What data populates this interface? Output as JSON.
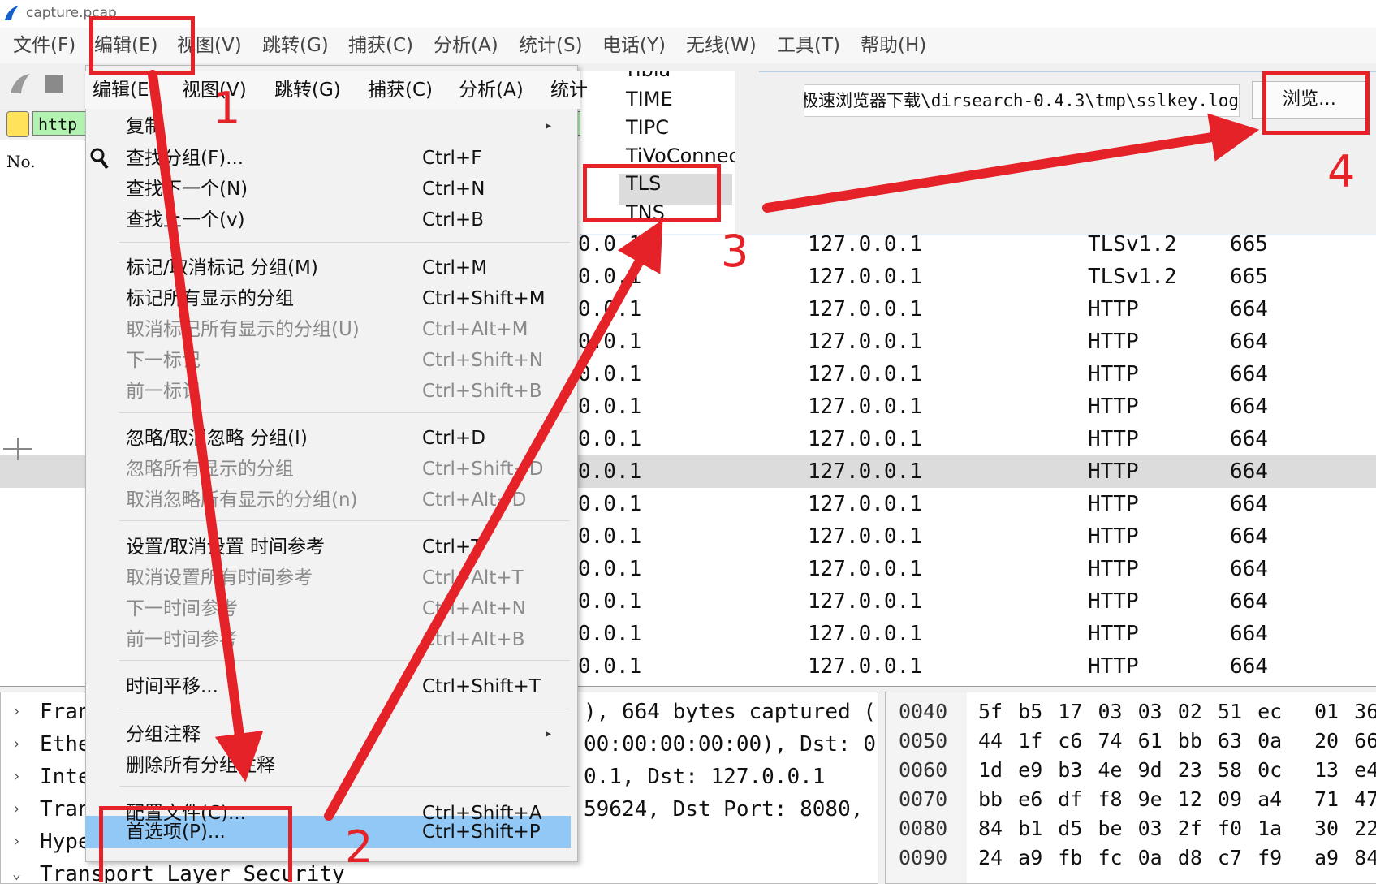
{
  "window": {
    "title": "capture.pcap"
  },
  "menubar": {
    "items": [
      "文件(F)",
      "编辑(E)",
      "视图(V)",
      "跳转(G)",
      "捕获(C)",
      "分析(A)",
      "统计(S)",
      "电话(Y)",
      "无线(W)",
      "工具(T)",
      "帮助(H)"
    ]
  },
  "filter": {
    "value": "http"
  },
  "packet_list": {
    "col_no": "No.",
    "rows": [
      {
        "src": "0.0.1",
        "dst": "127.0.0.1",
        "proto": "TLSv1.2",
        "len": "665"
      },
      {
        "src": "0.0.1",
        "dst": "127.0.0.1",
        "proto": "TLSv1.2",
        "len": "665"
      },
      {
        "src": "0.0.1",
        "dst": "127.0.0.1",
        "proto": "HTTP",
        "len": "664"
      },
      {
        "src": "0.0.1",
        "dst": "127.0.0.1",
        "proto": "HTTP",
        "len": "664"
      },
      {
        "src": "0.0.1",
        "dst": "127.0.0.1",
        "proto": "HTTP",
        "len": "664"
      },
      {
        "src": "0.0.1",
        "dst": "127.0.0.1",
        "proto": "HTTP",
        "len": "664"
      },
      {
        "src": "0.0.1",
        "dst": "127.0.0.1",
        "proto": "HTTP",
        "len": "664"
      },
      {
        "src": "0.0.1",
        "dst": "127.0.0.1",
        "proto": "HTTP",
        "len": "664"
      },
      {
        "src": "0.0.1",
        "dst": "127.0.0.1",
        "proto": "HTTP",
        "len": "664"
      },
      {
        "src": "0.0.1",
        "dst": "127.0.0.1",
        "proto": "HTTP",
        "len": "664"
      },
      {
        "src": "0.0.1",
        "dst": "127.0.0.1",
        "proto": "HTTP",
        "len": "664"
      },
      {
        "src": "0.0.1",
        "dst": "127.0.0.1",
        "proto": "HTTP",
        "len": "664"
      },
      {
        "src": "0.0.1",
        "dst": "127.0.0.1",
        "proto": "HTTP",
        "len": "664"
      },
      {
        "src": "0.0.1",
        "dst": "127.0.0.1",
        "proto": "HTTP",
        "len": "664"
      }
    ]
  },
  "details": {
    "rows": [
      {
        "label": "Fran",
        "tail": "), 664 bytes captured ("
      },
      {
        "label": "Ethe",
        "tail": "00:00:00:00:00), Dst: 0"
      },
      {
        "label": "Inte",
        "tail": "0.1, Dst: 127.0.0.1"
      },
      {
        "label": "Tran",
        "tail": "59624, Dst Port: 8080,"
      },
      {
        "label": "Hype",
        "tail": ""
      },
      {
        "label": "Transport Layer Security",
        "tail": ""
      }
    ]
  },
  "bytes": {
    "rows": [
      {
        "offset": "0040",
        "hex1": "5f b5 17 03 03 02 51 ec",
        "hex2": "01 36"
      },
      {
        "offset": "0050",
        "hex1": "44 1f c6 74 61 bb 63 0a",
        "hex2": "20 66"
      },
      {
        "offset": "0060",
        "hex1": "1d e9 b3 4e 9d 23 58 0c",
        "hex2": "13 e4"
      },
      {
        "offset": "0070",
        "hex1": "bb e6 df f8 9e 12 09 a4",
        "hex2": "71 47"
      },
      {
        "offset": "0080",
        "hex1": "84 b1 d5 be 03 2f f0 1a",
        "hex2": "30 22"
      },
      {
        "offset": "0090",
        "hex1": "24 a9 fb fc 0a d8 c7 f9",
        "hex2": "a9 84"
      }
    ]
  },
  "preferences": {
    "protocols": [
      "TIME",
      "TIPC",
      "TiVoConnec",
      "TLS",
      "TNS"
    ],
    "protocol_partial_top": "Tibia",
    "selected_protocol": "TLS",
    "keylog_path": "极速浏览器下载\\dirsearch-0.4.3\\tmp\\sslkey.log",
    "browse_label": "浏览…"
  },
  "edit_menu": {
    "bar": [
      "编辑(E)",
      "视图(V)",
      "跳转(G)",
      "捕获(C)",
      "分析(A)",
      "统计"
    ],
    "items": [
      {
        "label": "复制",
        "shortcut": "",
        "disabled": false,
        "submenu": true
      },
      {
        "label": "查找分组(F)...",
        "shortcut": "Ctrl+F",
        "disabled": false
      },
      {
        "label": "查找下一个(N)",
        "shortcut": "Ctrl+N",
        "disabled": false
      },
      {
        "label": "查找上一个(v)",
        "shortcut": "Ctrl+B",
        "disabled": false
      },
      {
        "label": "标记/取消标记 分组(M)",
        "shortcut": "Ctrl+M",
        "disabled": false
      },
      {
        "label": "标记所有显示的分组",
        "shortcut": "Ctrl+Shift+M",
        "disabled": false
      },
      {
        "label": "取消标记所有显示的分组(U)",
        "shortcut": "Ctrl+Alt+M",
        "disabled": true
      },
      {
        "label": "下一标记",
        "shortcut": "Ctrl+Shift+N",
        "disabled": true
      },
      {
        "label": "前一标记",
        "shortcut": "Ctrl+Shift+B",
        "disabled": true
      },
      {
        "label": "忽略/取消忽略 分组(I)",
        "shortcut": "Ctrl+D",
        "disabled": false
      },
      {
        "label": "忽略所有显示的分组",
        "shortcut": "Ctrl+Shift+D",
        "disabled": true
      },
      {
        "label": "取消忽略所有显示的分组(n)",
        "shortcut": "Ctrl+Alt+D",
        "disabled": true
      },
      {
        "label": "设置/取消设置 时间参考",
        "shortcut": "Ctrl+T",
        "disabled": false
      },
      {
        "label": "取消设置所有时间参考",
        "shortcut": "Ctrl+Alt+T",
        "disabled": true
      },
      {
        "label": "下一时间参考",
        "shortcut": "Ctrl+Alt+N",
        "disabled": true
      },
      {
        "label": "前一时间参考",
        "shortcut": "Ctrl+Alt+B",
        "disabled": true
      },
      {
        "label": "时间平移...",
        "shortcut": "Ctrl+Shift+T",
        "disabled": false
      },
      {
        "label": "分组注释",
        "shortcut": "",
        "disabled": false,
        "submenu": true
      },
      {
        "label": "删除所有分组注释",
        "shortcut": "",
        "disabled": false
      },
      {
        "label": "配置文件(C)...",
        "shortcut": "Ctrl+Shift+A",
        "disabled": false
      },
      {
        "label": "首选项(P)...",
        "shortcut": "Ctrl+Shift+P",
        "disabled": false,
        "highlighted": true
      }
    ]
  },
  "annotations": {
    "steps": [
      "1",
      "2",
      "3",
      "4"
    ],
    "color": "#e52228"
  },
  "colors": {
    "highlight": "#91c8f6",
    "filter_bg": "#b2f3b2",
    "selected_row": "#dcdcdc"
  }
}
